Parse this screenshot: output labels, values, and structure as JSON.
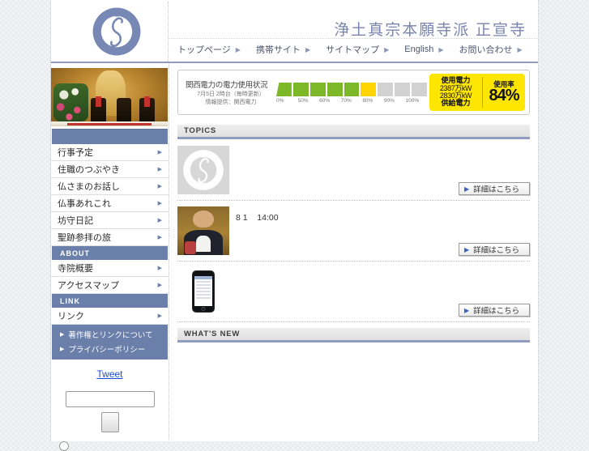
{
  "header": {
    "site_title": "浄土真宗本願寺派 正宣寺",
    "logo_name": "wisteria-crest-logo",
    "nav": [
      {
        "label": "トップページ",
        "arrow": "▶"
      },
      {
        "label": "携帯サイト",
        "arrow": "▶"
      },
      {
        "label": "サイトマップ",
        "arrow": "▶"
      },
      {
        "label": "English",
        "arrow": "▶"
      },
      {
        "label": "お問い合わせ",
        "arrow": "▶"
      }
    ]
  },
  "sidebar": {
    "photo_name": "altar-photo",
    "menu": [
      {
        "label": "行事予定",
        "arrow": "▶"
      },
      {
        "label": "住職のつぶやき",
        "arrow": "▶"
      },
      {
        "label": "仏さまのお話し",
        "arrow": "▶"
      },
      {
        "label": "仏事あれこれ",
        "arrow": "▶"
      },
      {
        "label": "坊守日記",
        "arrow": "▶"
      },
      {
        "label": "聖跡参拝の旅",
        "arrow": "▶"
      }
    ],
    "about_title": "ABOUT",
    "about_items": [
      {
        "label": "寺院概要",
        "arrow": "▶"
      },
      {
        "label": "アクセスマップ",
        "arrow": "▶"
      }
    ],
    "link_title": "LINK",
    "link_items": [
      {
        "label": "リンク",
        "arrow": "▶"
      }
    ],
    "sub_links": [
      {
        "label": "著作権とリンクについて",
        "arrow": "▶"
      },
      {
        "label": "プライバシーポリシー",
        "arrow": "▶"
      }
    ],
    "tweet_label": "Tweet",
    "search_value": "",
    "search_placeholder": "",
    "button_label": ""
  },
  "power_widget": {
    "title": "関西電力の電力使用状況",
    "subtitle_1": "7月5日 2時台（毎時更新）",
    "subtitle_2": "情報提供：関西電力",
    "scale_ticks": [
      "0%",
      "50%",
      "60%",
      "70%",
      "80%",
      "90%",
      "100%"
    ],
    "segments": [
      {
        "color": "#7cb828"
      },
      {
        "color": "#7cb828"
      },
      {
        "color": "#7cb828"
      },
      {
        "color": "#7cb828"
      },
      {
        "color": "#7cb828"
      },
      {
        "color": "#ffd400"
      },
      {
        "color": "#d2d2d2"
      },
      {
        "color": "#d2d2d2"
      },
      {
        "color": "#d2d2d2"
      }
    ],
    "usage_label": "使用電力",
    "usage_value": "2387万kW",
    "supply_value": "2830万kW",
    "supply_label": "供給電力",
    "rate_label": "使用率",
    "rate_value": "84%",
    "panel_color": "#ffe600"
  },
  "main": {
    "topics_heading": "TOPICS",
    "whats_new_heading": "WHAT'S NEW",
    "detail_button_label": "詳細はこちら",
    "detail_button_arrow": "▶",
    "topics": [
      {
        "thumb": "crest-placeholder-thumb",
        "text": ""
      },
      {
        "thumb": "priest-photo-thumb",
        "text": "8 1    14:00"
      },
      {
        "thumb": "smartphone-photo-thumb",
        "text": ""
      }
    ]
  },
  "colors": {
    "accent_blue": "#6b7fab",
    "title_blue": "#7a85ad",
    "link_blue": "#1b4ed8",
    "power_yellow": "#ffe600",
    "meter_green": "#7cb828"
  }
}
